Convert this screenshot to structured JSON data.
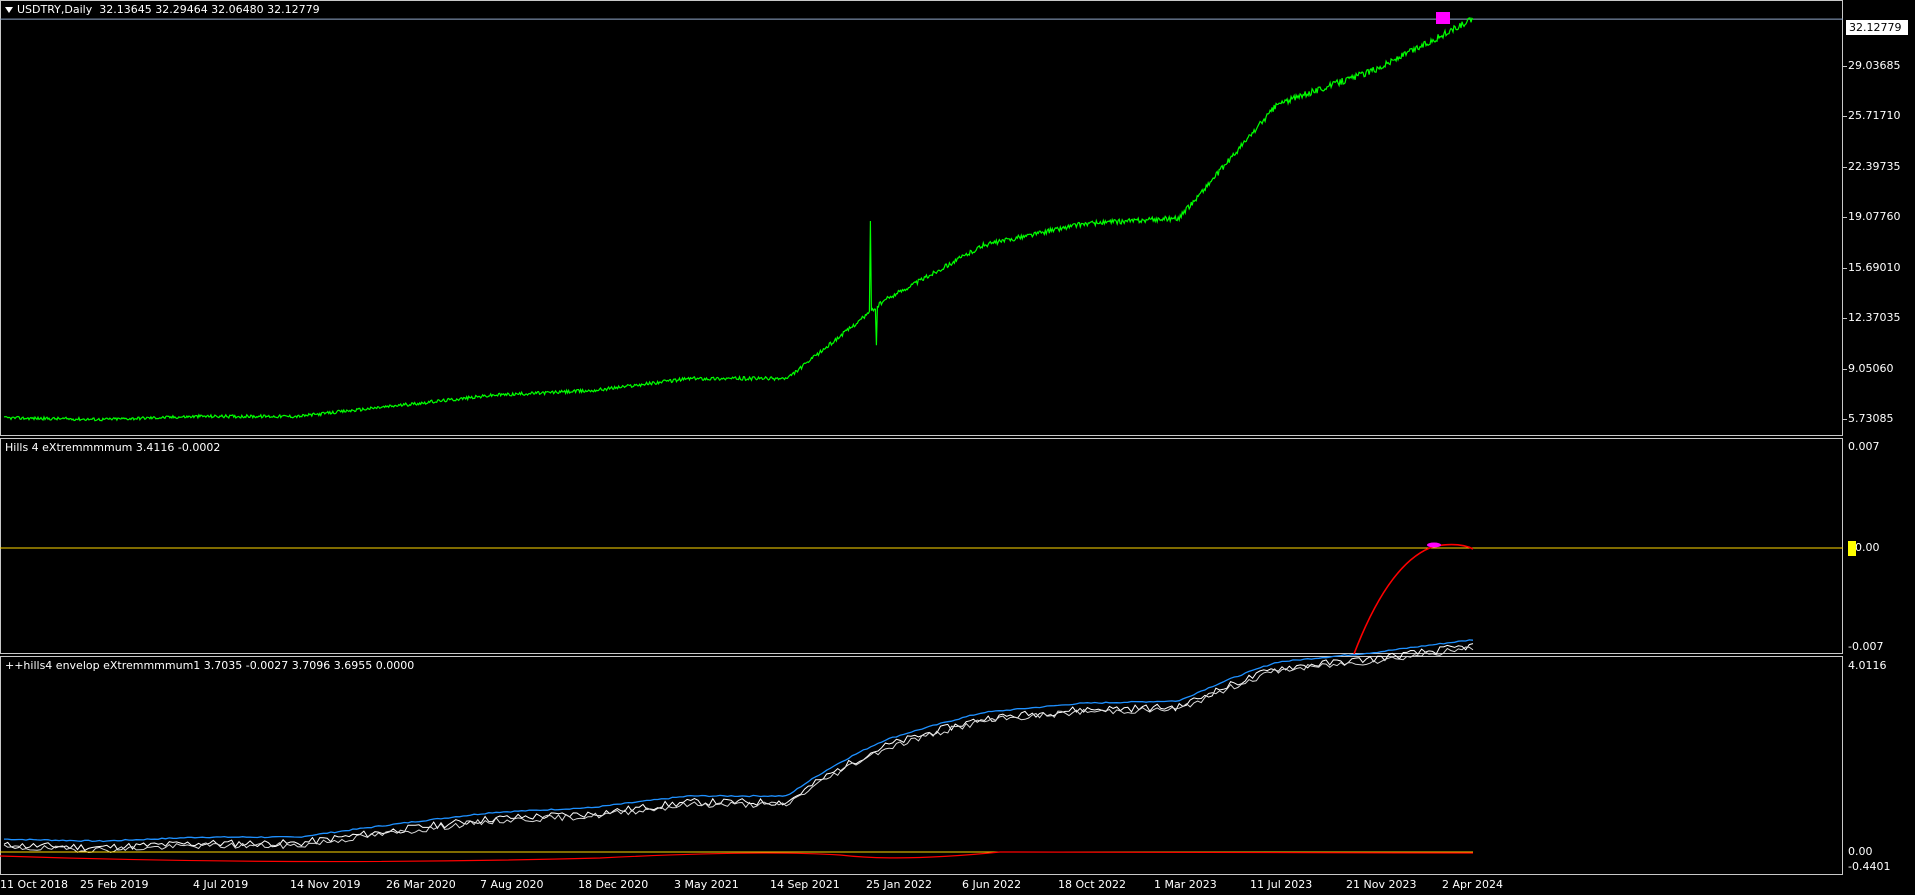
{
  "main": {
    "symbol": "USDTRY,Daily",
    "ohlc": "32.13645 32.29464 32.06480 32.12779",
    "current_price": "32.12779",
    "price_scale": [
      "29.03685",
      "25.71710",
      "22.39735",
      "19.07760",
      "15.69010",
      "12.37035",
      "9.05060",
      "5.73085"
    ]
  },
  "indicator1": {
    "label": "Hills 4 eXtremmmmum 3.4116 -0.0002",
    "scale_top": "0.007",
    "scale_mid": "0.00",
    "scale_bottom": "-0.007"
  },
  "indicator2": {
    "label": "++hills4 envelop eXtremmmmum1 3.7035 -0.0027 3.7096 3.6955 0.0000",
    "scale_top": "4.0116",
    "scale_zero": "0.00",
    "scale_bottom": "-0.4401"
  },
  "time_axis": [
    "11 Oct 2018",
    "25 Feb 2019",
    "4 Jul 2019",
    "14 Nov 2019",
    "26 Mar 2020",
    "7 Aug 2020",
    "18 Dec 2020",
    "3 May 2021",
    "14 Sep 2021",
    "25 Jan 2022",
    "6 Jun 2022",
    "18 Oct 2022",
    "1 Mar 2023",
    "11 Jul 2023",
    "21 Nov 2023",
    "2 Apr 2024"
  ],
  "colors": {
    "price_line": "#00ff00",
    "highlight": "#ff00ff",
    "zero_line": "#ffd700",
    "indicator_curve": "#ff0000",
    "envelope_blue": "#1e90ff",
    "envelope_white": "#ffffff"
  },
  "chart_data": {
    "type": "line",
    "series": [
      {
        "name": "USDTRY,Daily",
        "x": [
          "11 Oct 2018",
          "25 Feb 2019",
          "4 Jul 2019",
          "14 Nov 2019",
          "26 Mar 2020",
          "7 Aug 2020",
          "18 Dec 2020",
          "3 May 2021",
          "14 Sep 2021",
          "25 Jan 2022",
          "6 Jun 2022",
          "18 Oct 2022",
          "1 Mar 2023",
          "11 Jul 2023",
          "21 Nov 2023",
          "2 Apr 2024"
        ],
        "values": [
          5.8,
          5.7,
          5.9,
          5.9,
          6.6,
          7.3,
          7.6,
          8.4,
          8.4,
          13.6,
          17.2,
          18.6,
          19.0,
          26.5,
          28.8,
          32.1
        ]
      }
    ],
    "ylim": [
      5.0,
      32.6
    ]
  }
}
